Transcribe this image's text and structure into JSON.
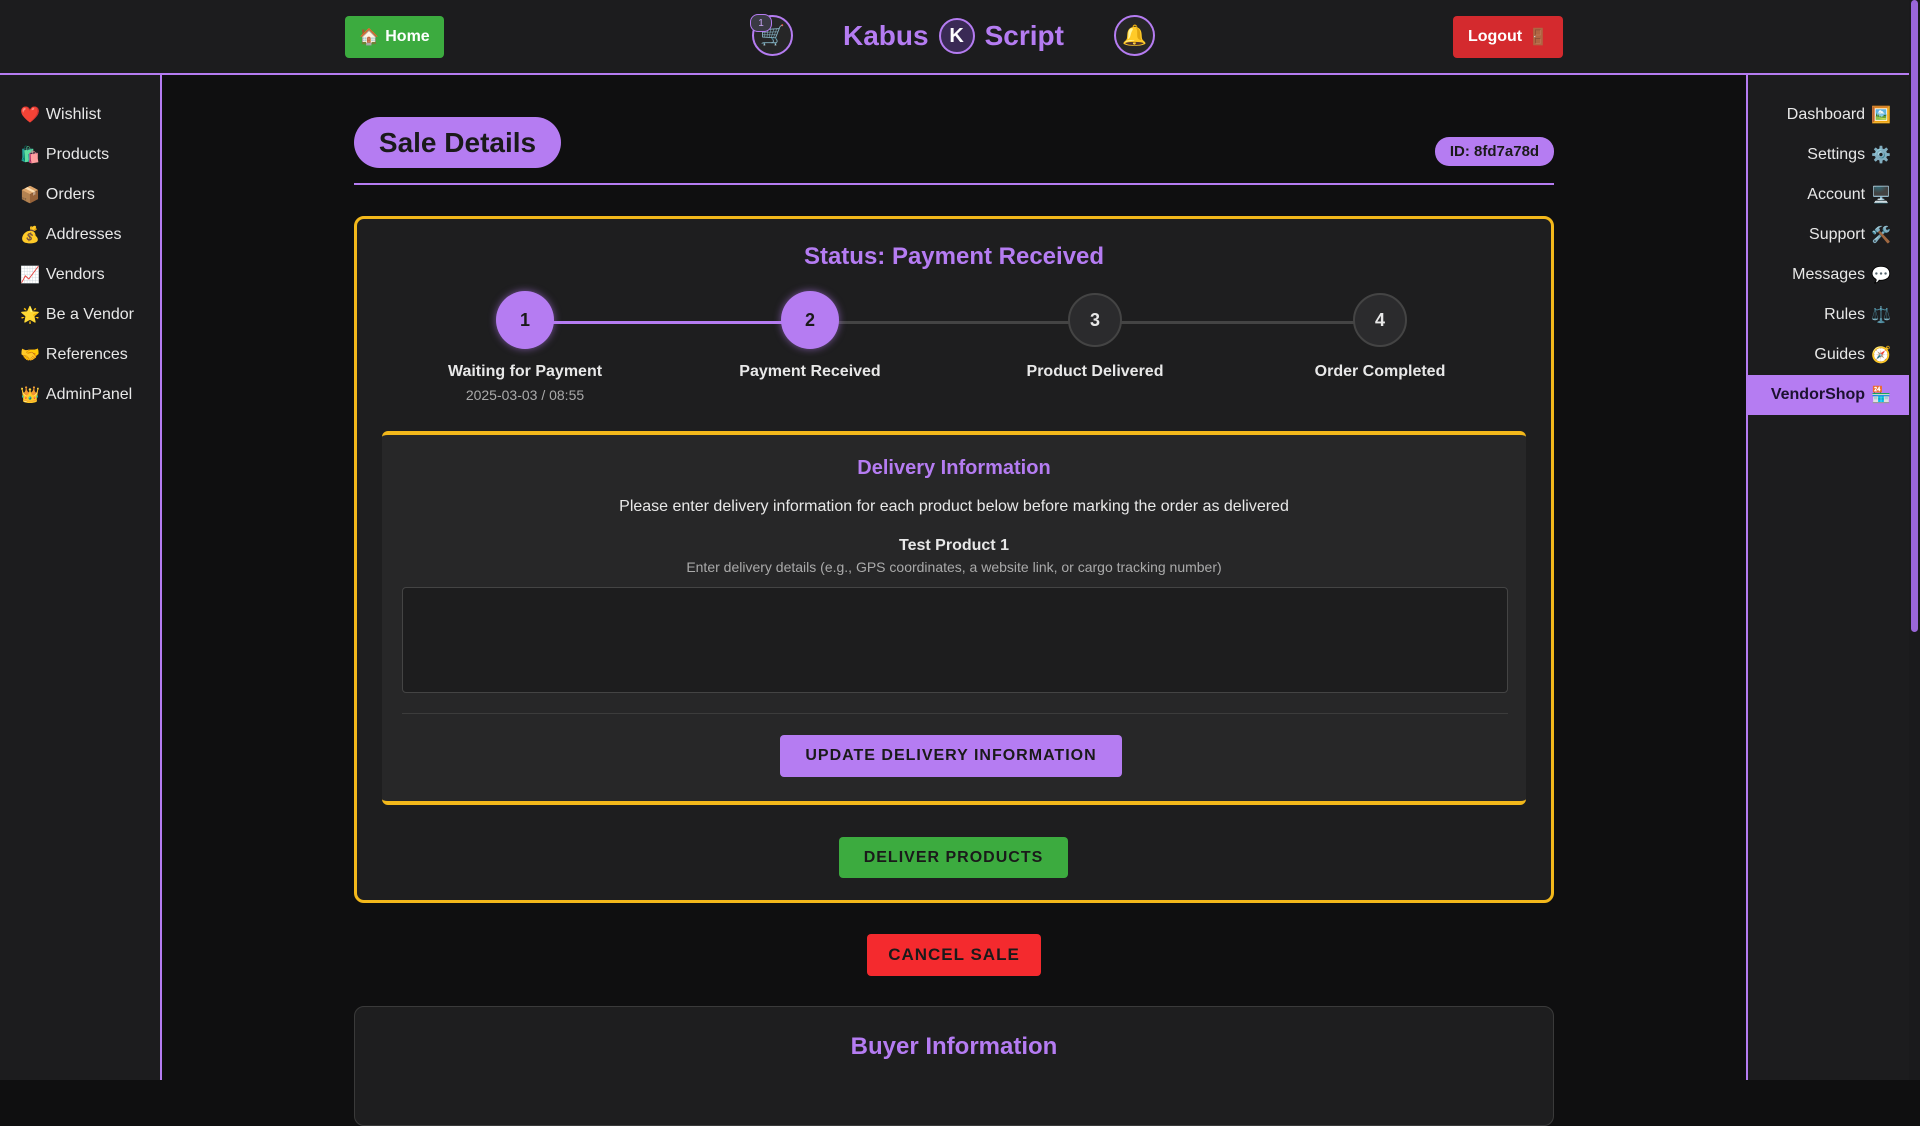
{
  "header": {
    "home_label": "Home",
    "home_icon": "🏠",
    "cart_icon": "🛒",
    "cart_count": "1",
    "brand_left": "Kabus",
    "brand_logo": "K",
    "brand_right": "Script",
    "bell_icon": "🔔",
    "logout_label": "Logout",
    "logout_icon": "🚪"
  },
  "sidebar_left": {
    "items": [
      {
        "icon": "❤️",
        "label": "Wishlist"
      },
      {
        "icon": "🛍️",
        "label": "Products"
      },
      {
        "icon": "📦",
        "label": "Orders"
      },
      {
        "icon": "💰",
        "label": "Addresses"
      },
      {
        "icon": "📈",
        "label": "Vendors"
      },
      {
        "icon": "🌟",
        "label": "Be a Vendor"
      },
      {
        "icon": "🤝",
        "label": "References"
      },
      {
        "icon": "👑",
        "label": "AdminPanel"
      }
    ]
  },
  "sidebar_right": {
    "items": [
      {
        "icon": "🖼️",
        "label": "Dashboard"
      },
      {
        "icon": "⚙️",
        "label": "Settings"
      },
      {
        "icon": "🖥️",
        "label": "Account"
      },
      {
        "icon": "🛠️",
        "label": "Support"
      },
      {
        "icon": "💬",
        "label": "Messages"
      },
      {
        "icon": "⚖️",
        "label": "Rules"
      },
      {
        "icon": "🧭",
        "label": "Guides"
      },
      {
        "icon": "🏪",
        "label": "VendorShop",
        "active": true
      }
    ]
  },
  "page": {
    "title": "Sale Details",
    "id_badge": "ID: 8fd7a78d"
  },
  "status": {
    "title": "Status: Payment Received",
    "steps": [
      {
        "number": "1",
        "label": "Waiting for Payment",
        "date": "2025-03-03 / 08:55",
        "state": "done"
      },
      {
        "number": "2",
        "label": "Payment Received",
        "date": "",
        "state": "done"
      },
      {
        "number": "3",
        "label": "Product Delivered",
        "date": "",
        "state": "todo"
      },
      {
        "number": "4",
        "label": "Order Completed",
        "date": "",
        "state": "todo"
      }
    ]
  },
  "delivery": {
    "title": "Delivery Information",
    "description": "Please enter delivery information for each product below before marking the order as delivered",
    "product_name": "Test Product 1",
    "hint": "Enter delivery details (e.g., GPS coordinates, a website link, or cargo tracking number)",
    "textarea_value": "",
    "update_button": "UPDATE DELIVERY INFORMATION"
  },
  "actions": {
    "deliver_button": "DELIVER PRODUCTS",
    "cancel_button": "CANCEL SALE"
  },
  "buyer": {
    "title": "Buyer Information"
  },
  "colors": {
    "accent": "#b57cf2",
    "warning_border": "#f3b81b",
    "success": "#3cab3f",
    "danger": "#f42a2e",
    "background": "#0f0f10"
  }
}
